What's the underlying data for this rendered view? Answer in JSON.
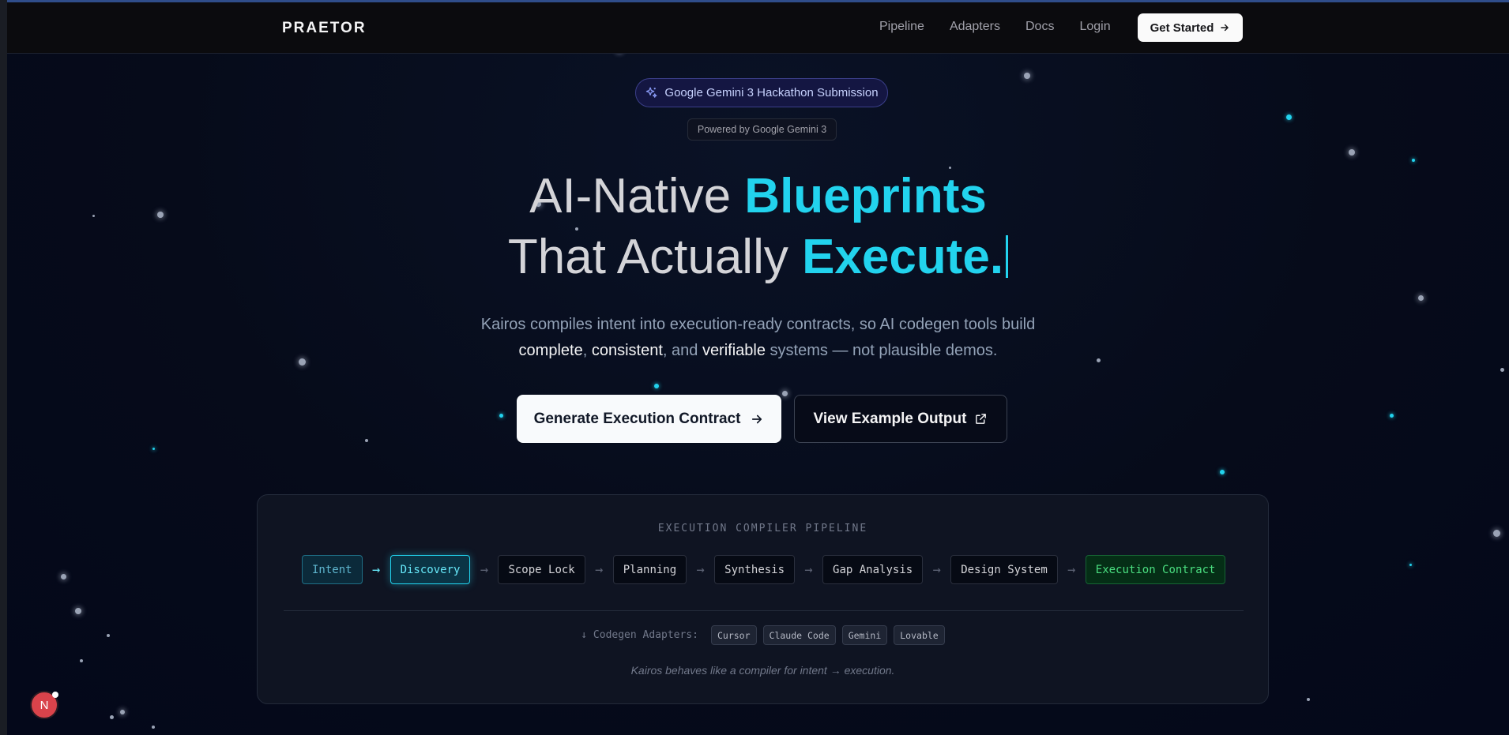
{
  "nav": {
    "logo": "PRAETOR",
    "links": [
      "Pipeline",
      "Adapters",
      "Docs",
      "Login"
    ],
    "cta": "Get Started"
  },
  "hero": {
    "badge": "Google Gemini 3 Hackathon Submission",
    "powered": "Powered by Google Gemini 3",
    "headline_line1_plain": "AI-Native ",
    "headline_line1_accent": "Blueprints",
    "headline_line2_plain": "That Actually ",
    "headline_line2_accent": "Execute.",
    "sub_line1": "Kairos compiles intent into execution-ready contracts, so AI codegen tools build",
    "sub_w1": "complete",
    "sub_sep1": ", ",
    "sub_w2": "consistent",
    "sub_sep2": ", and ",
    "sub_w3": "verifiable",
    "sub_tail": " systems — not plausible demos.",
    "primary_button": "Generate Execution Contract",
    "secondary_button": "View Example Output"
  },
  "pipeline": {
    "title": "EXECUTION COMPILER PIPELINE",
    "steps": [
      "Intent",
      "Discovery",
      "Scope Lock",
      "Planning",
      "Synthesis",
      "Gap Analysis",
      "Design System",
      "Execution Contract"
    ],
    "arrow": "→",
    "adapters_label": "↓ Codegen Adapters:",
    "adapters": [
      "Cursor",
      "Claude Code",
      "Gemini",
      "Lovable"
    ],
    "footer": "Kairos behaves like a compiler for intent → execution."
  },
  "avatar": {
    "initial": "N"
  },
  "colors": {
    "accent": "#22d3ee",
    "success": "#4ade80",
    "background": "#050a1a"
  },
  "icons": [
    "sparkles-icon",
    "arrow-right-icon",
    "external-link-icon"
  ]
}
